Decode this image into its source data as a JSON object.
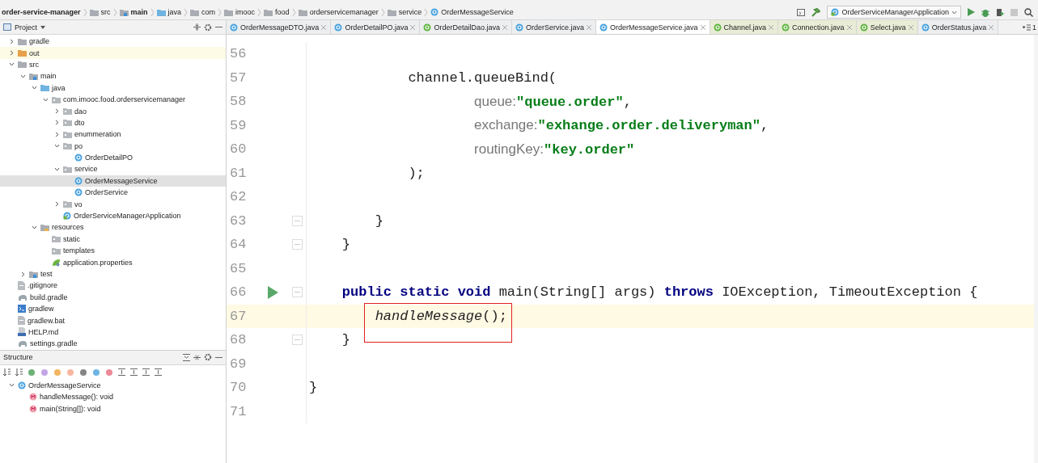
{
  "breadcrumbs": [
    {
      "label": "order-service-manager",
      "kind": "project"
    },
    {
      "label": "src",
      "kind": "folder"
    },
    {
      "label": "main",
      "kind": "module"
    },
    {
      "label": "java",
      "kind": "source"
    },
    {
      "label": "com",
      "kind": "folder"
    },
    {
      "label": "imooc",
      "kind": "folder"
    },
    {
      "label": "food",
      "kind": "folder"
    },
    {
      "label": "orderservicemanager",
      "kind": "folder"
    },
    {
      "label": "service",
      "kind": "folder"
    },
    {
      "label": "OrderMessageService",
      "kind": "class"
    }
  ],
  "run_config": {
    "label": "OrderServiceManagerApplication"
  },
  "project_panel": {
    "title": "Project"
  },
  "tree": [
    {
      "label": "gradle",
      "kind": "folder",
      "expanded": false
    },
    {
      "label": "out",
      "kind": "excluded",
      "expanded": false
    },
    {
      "label": "src",
      "kind": "folder",
      "expanded": true,
      "children": [
        {
          "label": "main",
          "kind": "module",
          "expanded": true,
          "children": [
            {
              "label": "java",
              "kind": "source",
              "expanded": true,
              "children": [
                {
                  "label": "com.imooc.food.orderservicemanager",
                  "kind": "package",
                  "expanded": true,
                  "children": [
                    {
                      "label": "dao",
                      "kind": "package",
                      "expanded": false
                    },
                    {
                      "label": "dto",
                      "kind": "package",
                      "expanded": false
                    },
                    {
                      "label": "enummeration",
                      "kind": "package",
                      "expanded": false
                    },
                    {
                      "label": "po",
                      "kind": "package",
                      "expanded": true,
                      "children": [
                        {
                          "label": "OrderDetailPO",
                          "kind": "class",
                          "selected": false
                        }
                      ]
                    },
                    {
                      "label": "service",
                      "kind": "package",
                      "expanded": true,
                      "children": [
                        {
                          "label": "OrderMessageService",
                          "kind": "class",
                          "selected": true
                        },
                        {
                          "label": "OrderService",
                          "kind": "class",
                          "selected": false
                        }
                      ]
                    },
                    {
                      "label": "vo",
                      "kind": "package",
                      "expanded": false
                    },
                    {
                      "label": "OrderServiceManagerApplication",
                      "kind": "spring",
                      "selected": false
                    }
                  ]
                }
              ]
            },
            {
              "label": "resources",
              "kind": "resources",
              "expanded": true,
              "children": [
                {
                  "label": "static",
                  "kind": "package",
                  "selected": false
                },
                {
                  "label": "templates",
                  "kind": "package",
                  "selected": false
                },
                {
                  "label": "application.properties",
                  "kind": "properties",
                  "selected": false
                }
              ]
            }
          ]
        },
        {
          "label": "test",
          "kind": "module",
          "expanded": false
        }
      ]
    },
    {
      "label": ".gitignore",
      "kind": "file",
      "selected": false
    },
    {
      "label": "build.gradle",
      "kind": "gradle",
      "selected": false
    },
    {
      "label": "gradlew",
      "kind": "terminal",
      "selected": false
    },
    {
      "label": "gradlew.bat",
      "kind": "file",
      "selected": false
    },
    {
      "label": "HELP.md",
      "kind": "markdown",
      "selected": false
    },
    {
      "label": "settings.gradle",
      "kind": "gradle",
      "selected": false
    }
  ],
  "tabs": [
    {
      "label": "OrderMessageDTO.java",
      "kind": "class",
      "selected": false,
      "library": false
    },
    {
      "label": "OrderDetailPO.java",
      "kind": "class",
      "selected": false,
      "library": false
    },
    {
      "label": "OrderDetailDao.java",
      "kind": "interface",
      "selected": false,
      "library": false
    },
    {
      "label": "OrderService.java",
      "kind": "class",
      "selected": false,
      "library": false
    },
    {
      "label": "OrderMessageService.java",
      "kind": "class",
      "selected": true,
      "library": false
    },
    {
      "label": "Channel.java",
      "kind": "interface",
      "selected": false,
      "library": true
    },
    {
      "label": "Connection.java",
      "kind": "interface",
      "selected": false,
      "library": true
    },
    {
      "label": "Select.java",
      "kind": "annotation",
      "selected": false,
      "library": true
    },
    {
      "label": "OrderStatus.java",
      "kind": "enum",
      "selected": false,
      "library": false
    }
  ],
  "tabs_overflow": "1",
  "structure": {
    "title": "Structure",
    "tree": [
      {
        "label": "OrderMessageService",
        "kind": "class",
        "expanded": true,
        "children": [
          {
            "label": "handleMessage(): void",
            "kind": "method"
          },
          {
            "label": "main(String[]): void",
            "kind": "method"
          }
        ]
      }
    ]
  },
  "code": [
    {
      "number": "56",
      "runnable": false,
      "fold": false,
      "current": false,
      "boxed": false
    },
    {
      "number": "57",
      "runnable": false,
      "fold": false,
      "current": false,
      "boxed": false,
      "tokens": [
        {
          "text": "            channel.queueBind(",
          "kind": "plain"
        }
      ]
    },
    {
      "number": "58",
      "runnable": false,
      "fold": false,
      "current": false,
      "boxed": false,
      "tokens": [
        {
          "text": "                    queue:",
          "kind": "hint"
        },
        {
          "text": "\"queue.order\"",
          "kind": "string"
        },
        {
          "text": ",",
          "kind": "plain"
        }
      ]
    },
    {
      "number": "59",
      "runnable": false,
      "fold": false,
      "current": false,
      "boxed": false,
      "tokens": [
        {
          "text": "                    exchange:",
          "kind": "hint"
        },
        {
          "text": "\"exhange.order.deliveryman\"",
          "kind": "string"
        },
        {
          "text": ",",
          "kind": "plain"
        }
      ]
    },
    {
      "number": "60",
      "runnable": false,
      "fold": false,
      "current": false,
      "boxed": false,
      "tokens": [
        {
          "text": "                    routingKey:",
          "kind": "hint"
        },
        {
          "text": "\"key.order\"",
          "kind": "string"
        }
      ]
    },
    {
      "number": "61",
      "runnable": false,
      "fold": false,
      "current": false,
      "boxed": false,
      "tokens": [
        {
          "text": "            );",
          "kind": "plain"
        }
      ]
    },
    {
      "number": "62",
      "runnable": false,
      "fold": false,
      "current": false,
      "boxed": false
    },
    {
      "number": "63",
      "runnable": false,
      "fold": true,
      "current": false,
      "boxed": false,
      "tokens": [
        {
          "text": "        }",
          "kind": "plain"
        }
      ]
    },
    {
      "number": "64",
      "runnable": false,
      "fold": true,
      "current": false,
      "boxed": false,
      "tokens": [
        {
          "text": "    }",
          "kind": "plain"
        }
      ]
    },
    {
      "number": "65",
      "runnable": false,
      "fold": false,
      "current": false,
      "boxed": false
    },
    {
      "number": "66",
      "runnable": true,
      "fold": true,
      "current": false,
      "boxed": false,
      "tokens": [
        {
          "text": "    public static void",
          "kind": "keyword"
        },
        {
          "text": " main(String[] args) ",
          "kind": "plain"
        },
        {
          "text": "throws",
          "kind": "keyword"
        },
        {
          "text": " IOException, TimeoutException {",
          "kind": "plain"
        }
      ]
    },
    {
      "number": "67",
      "runnable": false,
      "fold": false,
      "current": true,
      "boxed": true,
      "tokens": [
        {
          "text": "        handleMessage",
          "kind": "call"
        },
        {
          "text": "();",
          "kind": "plain"
        }
      ]
    },
    {
      "number": "68",
      "runnable": false,
      "fold": true,
      "current": false,
      "boxed": false,
      "tokens": [
        {
          "text": "    }",
          "kind": "plain"
        }
      ]
    },
    {
      "number": "69",
      "runnable": false,
      "fold": false,
      "current": false,
      "boxed": false
    },
    {
      "number": "70",
      "runnable": false,
      "fold": false,
      "current": false,
      "boxed": false,
      "tokens": [
        {
          "text": "}",
          "kind": "plain"
        }
      ]
    },
    {
      "number": "71",
      "runnable": false,
      "fold": false,
      "current": false,
      "boxed": false
    }
  ]
}
